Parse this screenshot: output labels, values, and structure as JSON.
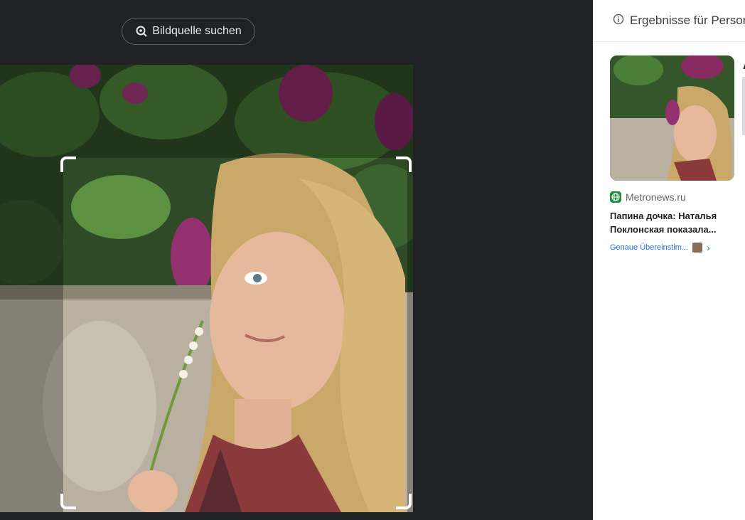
{
  "toolbar": {
    "source_search_label": "Bildquelle suchen",
    "source_search_icon": "lens-search-icon"
  },
  "photo": {
    "description_icon": "photo",
    "crop_handle_icons": [
      "crop-corner-top-left",
      "crop-corner-top-right",
      "crop-corner-bottom-left",
      "crop-corner-bottom-right"
    ]
  },
  "panel": {
    "header_label": "Ergebnisse für Personen",
    "header_icon": "info-icon",
    "next_card_letter": "A",
    "result": {
      "source_name": "Metronews.ru",
      "source_icon": "globe-icon",
      "title": "Папина дочка: Наталья Поклонская показала...",
      "match_label": "Genaue Übereinstim...",
      "chevron_icon": "chevron-right-icon"
    }
  },
  "colors": {
    "viewer_bg": "#202124",
    "panel_bg": "#ffffff",
    "link_blue": "#1a73e8",
    "favicon_green": "#1e8e3e"
  }
}
